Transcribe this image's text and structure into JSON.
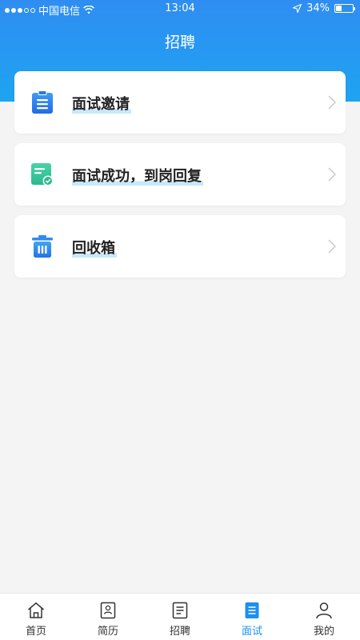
{
  "status_bar": {
    "carrier": "中国电信",
    "time": "13:04",
    "battery_percent": "34%",
    "battery_level": 0.34
  },
  "header": {
    "title": "招聘"
  },
  "menu": [
    {
      "label": "面试邀请",
      "icon": "clipboard-icon"
    },
    {
      "label": "面试成功，到岗回复",
      "icon": "document-check-icon"
    },
    {
      "label": "回收箱",
      "icon": "trash-icon"
    }
  ],
  "tabs": [
    {
      "label": "首页",
      "icon": "home-icon",
      "active": false
    },
    {
      "label": "简历",
      "icon": "resume-icon",
      "active": false
    },
    {
      "label": "招聘",
      "icon": "recruit-icon",
      "active": false
    },
    {
      "label": "面试",
      "icon": "interview-icon",
      "active": true
    },
    {
      "label": "我的",
      "icon": "user-icon",
      "active": false
    }
  ],
  "colors": {
    "header_gradient_top": "#2f8df2",
    "header_gradient_bottom": "#1ea4f1",
    "accent": "#1c8ff0",
    "icon_green": "#3cc7a0"
  }
}
